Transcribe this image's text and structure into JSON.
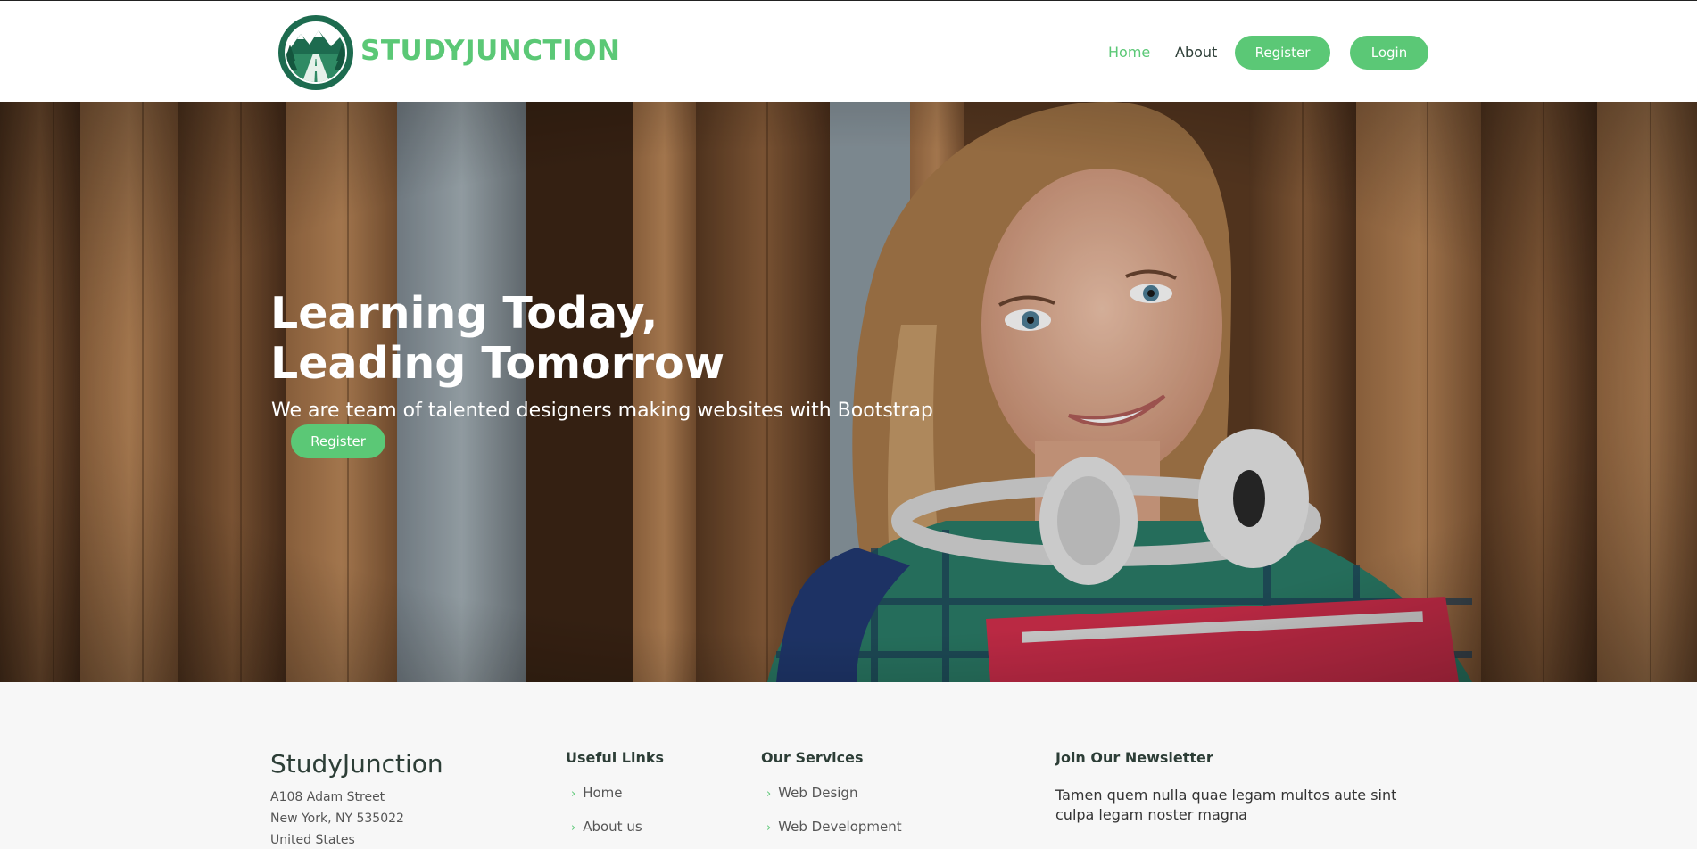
{
  "header": {
    "brand": "STUDYJUNCTION",
    "nav": {
      "home": "Home",
      "about": "About",
      "register": "Register",
      "login": "Login"
    }
  },
  "hero": {
    "title_line1": "Learning Today,",
    "title_line2": "Leading Tomorrow",
    "subtitle": "We are team of talented designers making websites with Bootstrap",
    "cta": "Register"
  },
  "footer": {
    "brand": "StudyJunction",
    "address": [
      "A108 Adam Street",
      "New York, NY 535022",
      "United States"
    ],
    "useful_links": {
      "heading": "Useful Links",
      "items": [
        "Home",
        "About us"
      ]
    },
    "services": {
      "heading": "Our Services",
      "items": [
        "Web Design",
        "Web Development"
      ]
    },
    "newsletter": {
      "heading": "Join Our Newsletter",
      "text": "Tamen quem nulla quae legam multos aute sint culpa legam noster magna"
    }
  },
  "colors": {
    "accent": "#5bc876",
    "dark_text": "#2d3e37",
    "footer_bg": "#f7f7f7"
  },
  "icons": [
    "studyjunction-logo",
    "chevron-right-icon"
  ]
}
